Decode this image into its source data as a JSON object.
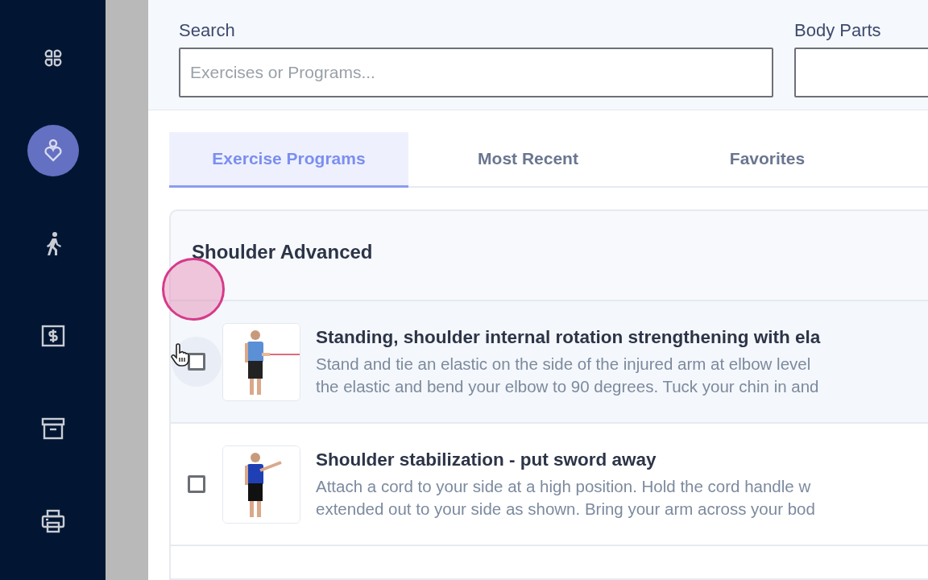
{
  "sidebar": {
    "items": [
      {
        "selected": false
      },
      {
        "selected": true
      },
      {
        "selected": false
      },
      {
        "selected": false
      },
      {
        "selected": false
      },
      {
        "selected": false
      }
    ]
  },
  "filters": [
    {
      "label": "Search",
      "placeholder": "Exercises or Programs..."
    },
    {
      "label": "Body Parts"
    }
  ],
  "tabs": [
    {
      "label": "Exercise Programs",
      "selected": true
    },
    {
      "label": "Most Recent",
      "selected": false
    },
    {
      "label": "Favorites",
      "selected": false
    }
  ],
  "program": {
    "title": "Shoulder Advanced",
    "exercises": [
      {
        "title": "Standing, shoulder internal rotation strengthening with ela",
        "description": [
          "Stand and tie an elastic on the side of the injured arm at elbow level",
          "the elastic and bend your elbow to 90 degrees. Tuck your chin in and"
        ],
        "checked": false,
        "hovered": true,
        "picture": {
          "kind": "picture"
        }
      },
      {
        "title": "Shoulder stabilization - put sword away",
        "description": [
          "Attach a cord to your side at a high position. Hold the cord handle w",
          "extended out to your side as shown. Bring your arm across your bod"
        ],
        "checked": false,
        "hovered": false,
        "picture": {
          "kind": "picture"
        }
      }
    ]
  },
  "pointer": {
    "touch": true
  }
}
